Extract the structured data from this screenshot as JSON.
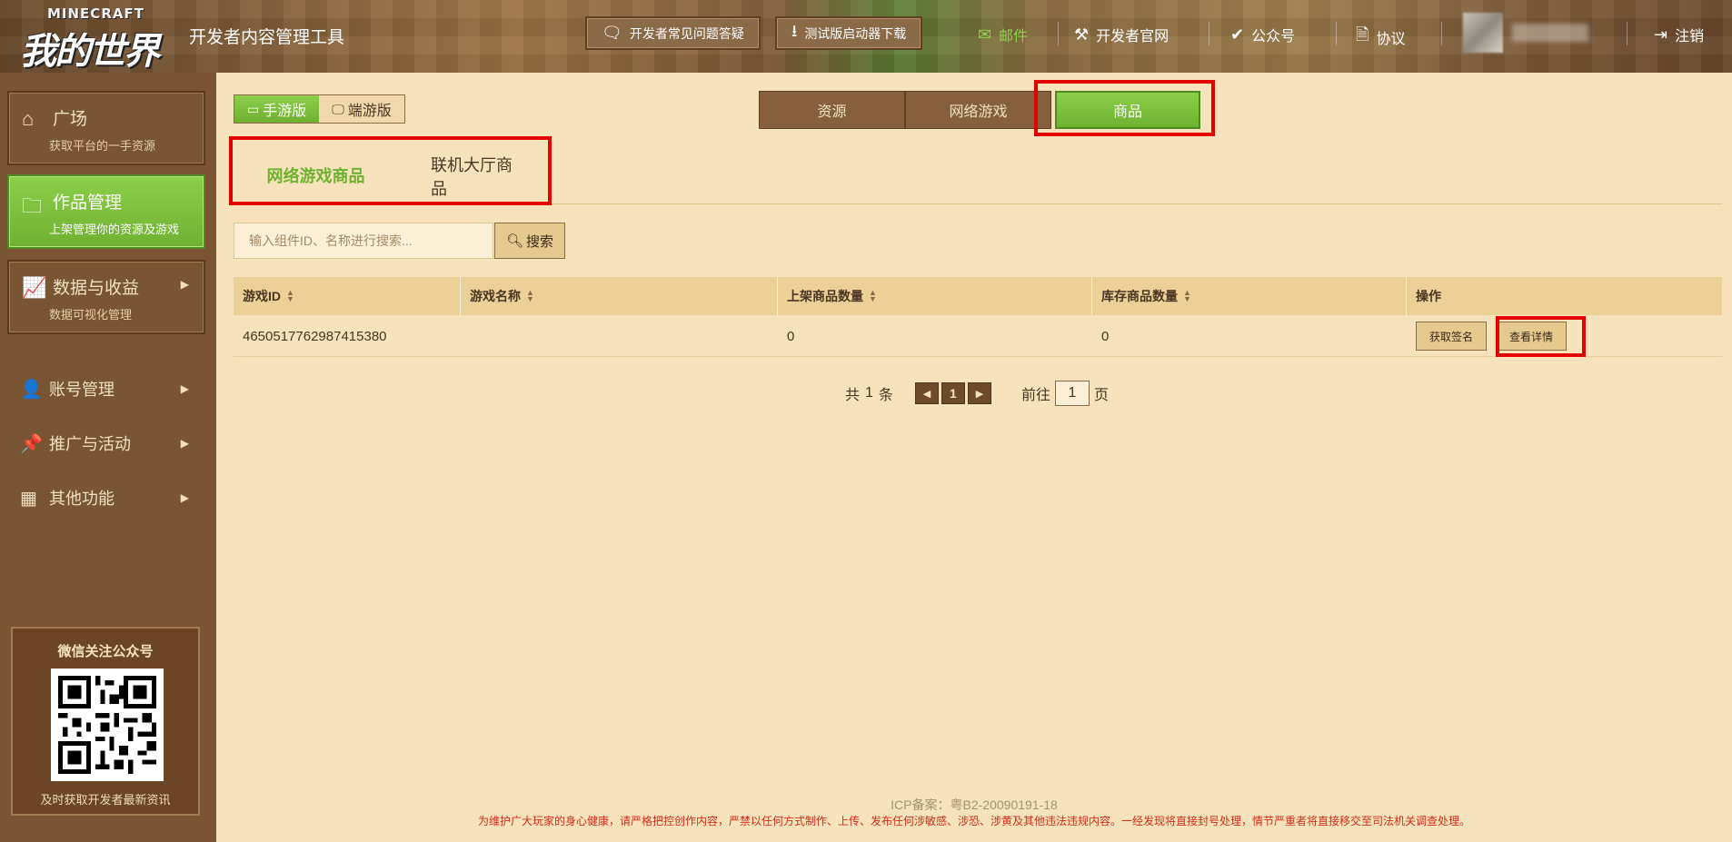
{
  "brand": {
    "logo_en": "MINECRAFT",
    "logo_cn": "我的世界",
    "app_title": "开发者内容管理工具"
  },
  "header": {
    "faq_button": "开发者常见问题答疑",
    "download_button": "测试版启动器下载",
    "mail": "邮件",
    "dev_site": "开发者官网",
    "official_account": "公众号",
    "agreement": "协议",
    "logout": "注销"
  },
  "sidebar": {
    "cards": [
      {
        "title": "广场",
        "subtitle": "获取平台的一手资源",
        "icon": "home-icon"
      },
      {
        "title": "作品管理",
        "subtitle": "上架管理你的资源及游戏",
        "icon": "folder-icon",
        "active": true
      },
      {
        "title": "数据与收益",
        "subtitle": "数据可视化管理",
        "icon": "chart-icon"
      }
    ],
    "items": [
      {
        "label": "账号管理",
        "icon": "user-icon"
      },
      {
        "label": "推广与活动",
        "icon": "billboard-icon"
      },
      {
        "label": "其他功能",
        "icon": "grid-icon"
      }
    ],
    "qr": {
      "title": "微信关注公众号",
      "footer": "及时获取开发者最新资讯"
    }
  },
  "platform_toggle": {
    "mobile": "手游版",
    "pc": "端游版",
    "selected": "手游版"
  },
  "top_tabs": [
    "资源",
    "网络游戏",
    "商品"
  ],
  "top_tabs_selected": "商品",
  "sub_tabs": [
    "网络游戏商品",
    "联机大厅商品"
  ],
  "sub_tabs_selected": "网络游戏商品",
  "search": {
    "placeholder": "输入组件ID、名称进行搜索...",
    "button": "搜索"
  },
  "table": {
    "headers": [
      "游戏ID",
      "游戏名称",
      "上架商品数量",
      "库存商品数量",
      "操作"
    ],
    "rows": [
      {
        "game_id": "4650517762987415380",
        "game_name": "",
        "listed": "0",
        "stock": "0",
        "actions": [
          "获取签名",
          "查看详情"
        ]
      }
    ]
  },
  "pagination": {
    "total_prefix": "共",
    "total": "1",
    "total_suffix": "条",
    "current_page": "1",
    "goto_label": "前往",
    "goto_value": "1",
    "page_suffix": "页"
  },
  "footer": {
    "icp": "ICP备案：粤B2-20090191-18",
    "notice": "为维护广大玩家的身心健康，请严格把控创作内容，严禁以任何方式制作、上传、发布任何涉敏感、涉恐、涉黄及其他违法违规内容。一经发现将直接封号处理，情节严重者将直接移交至司法机关调查处理。"
  },
  "colors": {
    "accent_green": "#6fb131",
    "sidebar_brown": "#7a5533",
    "page_bg": "#f7e3bb",
    "highlight_red": "#e30000",
    "notice_red": "#d32b1e"
  }
}
